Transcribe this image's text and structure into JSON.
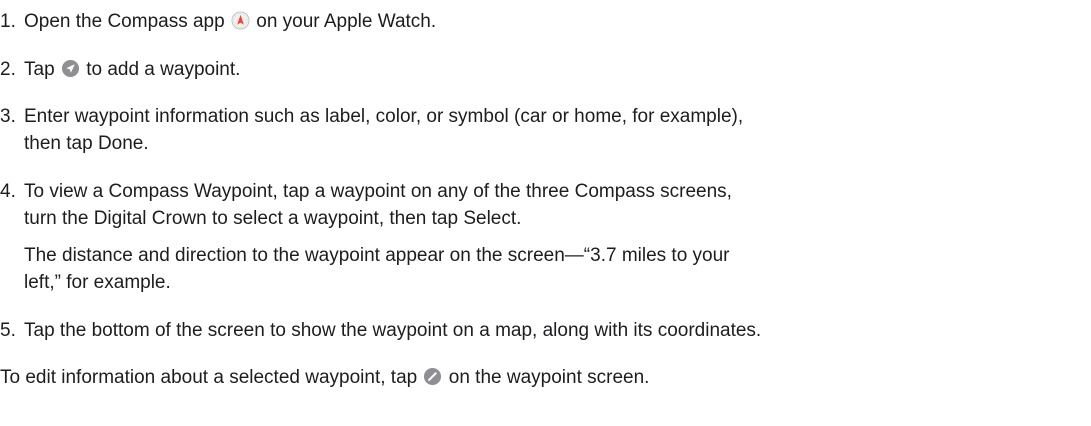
{
  "steps": [
    {
      "number": "1.",
      "before_icon": "Open the Compass app",
      "icon": "compass-app-icon",
      "after_icon": "on your Apple Watch."
    },
    {
      "number": "2.",
      "before_icon": "Tap",
      "icon": "add-waypoint-icon",
      "after_icon": "to add a waypoint."
    },
    {
      "number": "3.",
      "lines": [
        "Enter waypoint information such as label, color, or symbol (car or home, for example),",
        "then tap Done."
      ]
    },
    {
      "number": "4.",
      "lines": [
        "To view a Compass Waypoint, tap a waypoint on any of the three Compass screens,",
        "turn the Digital Crown to select a waypoint, then tap Select."
      ],
      "note_lines": [
        "The distance and direction to the waypoint appear on the screen—“3.7 miles to your",
        "left,” for example."
      ]
    },
    {
      "number": "5.",
      "text": "Tap the bottom of the screen to show the waypoint on a map, along with its coordinates."
    }
  ],
  "footer": {
    "before_icon": "To edit information about a selected waypoint, tap",
    "icon": "edit-pencil-icon",
    "after_icon": "on the waypoint screen."
  },
  "colors": {
    "text": "#1d1d1f",
    "icon_gray": "#8e8e93",
    "compass_red": "#ff3b30"
  }
}
